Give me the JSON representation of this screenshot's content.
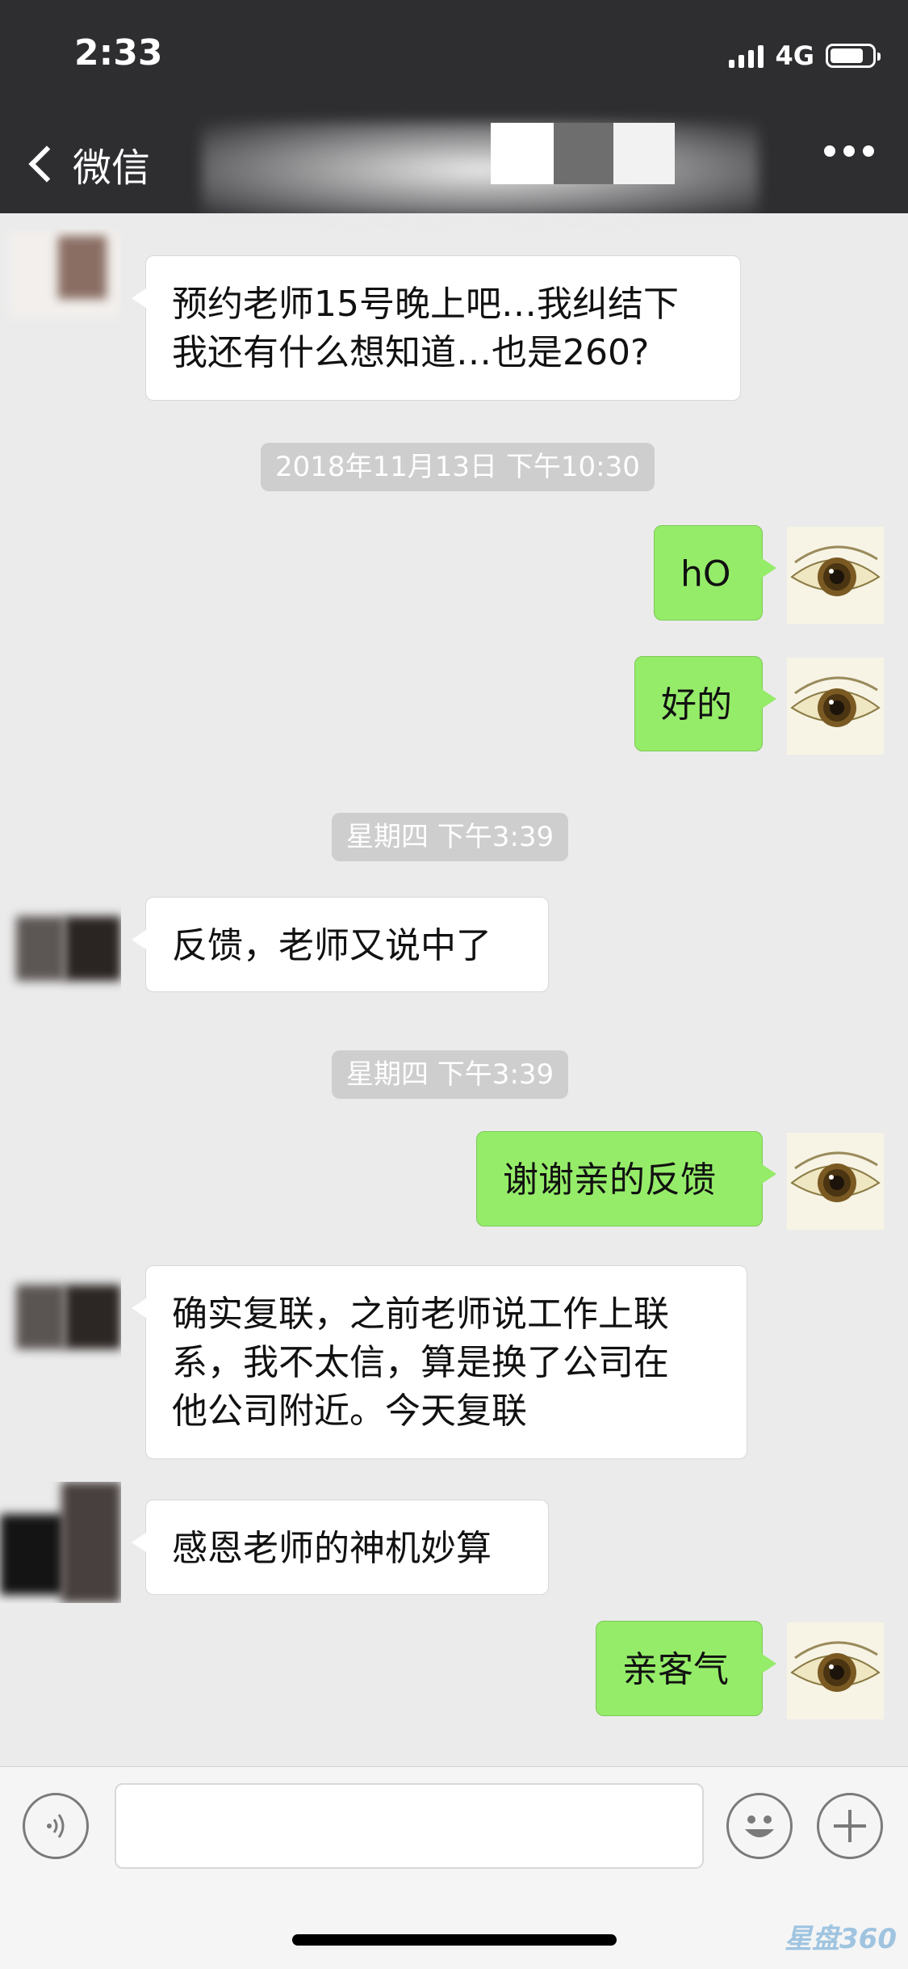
{
  "status_bar": {
    "time": "2:33",
    "network": "4G"
  },
  "nav": {
    "back_label": "微信"
  },
  "messages": {
    "m1": "预约老师15号晚上吧…我纠结下\n我还有什么想知道…也是260?",
    "t1": "2018年11月13日 下午10:30",
    "m2": "hO",
    "m3": "好的",
    "t2": "星期四 下午3:39",
    "m4": "反馈，老师又说中了",
    "t3": "星期四 下午3:39",
    "m5": "谢谢亲的反馈",
    "m6": "确实复联，之前老师说工作上联\n系，我不太信，算是换了公司在\n他公司附近。今天复联",
    "m7": "感恩老师的神机妙算",
    "m8": "亲客气"
  },
  "watermark": "星盘360",
  "colors": {
    "header": "#2e2e31",
    "chat_bg": "#ebebeb",
    "sent_bubble": "#95ec69",
    "received_bubble": "#ffffff"
  }
}
